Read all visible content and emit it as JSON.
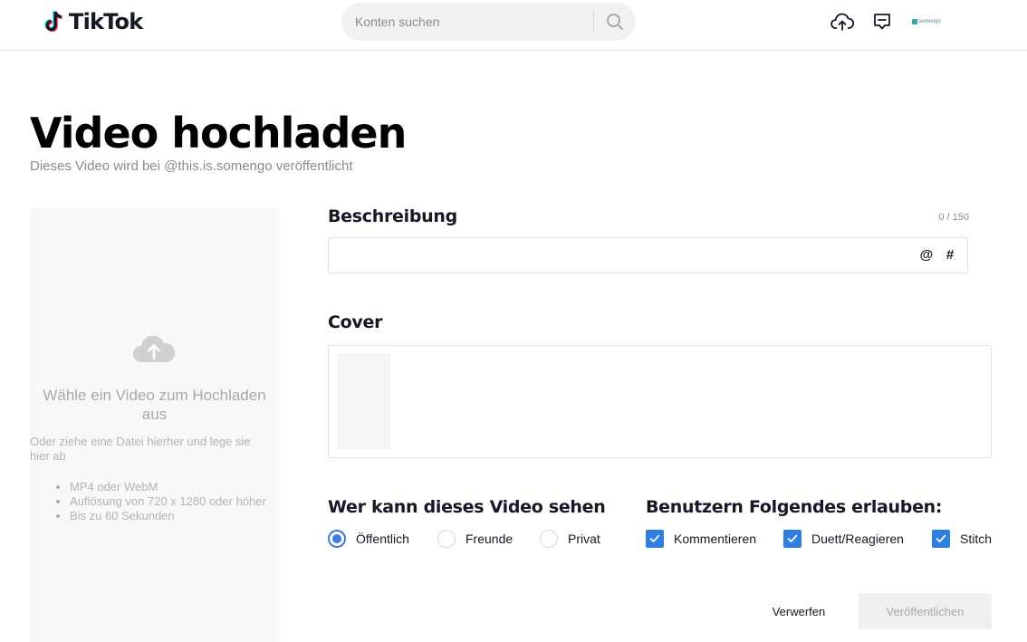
{
  "header": {
    "brand": "TikTok",
    "search": {
      "placeholder": "Konten suchen",
      "value": ""
    },
    "avatar_text": "somengo"
  },
  "page": {
    "title": "Video hochladen",
    "subtitle": "Dieses Video wird bei @this.is.somengo veröffentlicht"
  },
  "upload": {
    "heading": "Wähle ein Video zum Hochladen aus",
    "hint": "Oder ziehe eine Datei hierher und lege sie hier ab",
    "requirements": [
      "MP4 oder WebM",
      "Auflösung von 720 x 1280 oder höher",
      "Bis zu 60 Sekunden"
    ]
  },
  "description": {
    "label": "Beschreibung",
    "counter": "0 / 150",
    "value": "",
    "mention_symbol": "@",
    "hashtag_symbol": "#"
  },
  "cover": {
    "label": "Cover"
  },
  "visibility": {
    "label": "Wer kann dieses Video sehen",
    "options": [
      {
        "label": "Öffentlich",
        "selected": true
      },
      {
        "label": "Freunde",
        "selected": false
      },
      {
        "label": "Privat",
        "selected": false
      }
    ]
  },
  "permissions": {
    "label": "Benutzern Folgendes erlauben:",
    "options": [
      {
        "label": "Kommentieren",
        "checked": true
      },
      {
        "label": "Duett/Reagieren",
        "checked": true
      },
      {
        "label": "Stitch",
        "checked": true
      }
    ]
  },
  "actions": {
    "discard_label": "Verwerfen",
    "publish_label": "Veröffentlichen"
  },
  "colors": {
    "accent_blue": "#2f7fe0",
    "text_primary": "#161823",
    "text_muted": "#8a8b91",
    "tiktok_cyan": "#25f4ee",
    "tiktok_red": "#fe2c55"
  },
  "icons": {
    "upload": "cloud-upload-icon",
    "inbox": "message-icon",
    "search": "search-icon"
  }
}
